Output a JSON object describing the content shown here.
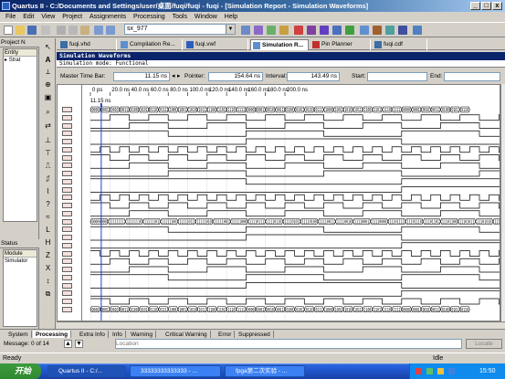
{
  "window": {
    "title": "Quartus II - C:/Documents and Settings/user/桌面/fuqi/fuqi - fuqi - [Simulation Report - Simulation Waveforms]",
    "controls": [
      "_",
      "□",
      "x"
    ]
  },
  "menu": [
    "File",
    "Edit",
    "View",
    "Project",
    "Assignments",
    "Processing",
    "Tools",
    "Window",
    "Help"
  ],
  "toolbar": {
    "entity_combo": "sx_977"
  },
  "left_panel": {
    "project_header": "Project N",
    "entity_col": "Entity",
    "entity_row": "Strat",
    "status_header": "Status",
    "status_col": "Module",
    "status_row": "Simulator"
  },
  "tabs": [
    {
      "label": "fuqi.vhd",
      "active": false,
      "icon_color": "#3a6ea5"
    },
    {
      "label": "Compilation Re...",
      "active": false,
      "icon_color": "#5b8fd0"
    },
    {
      "label": "fuqi.vwf",
      "active": false,
      "icon_color": "#2b5fbe"
    },
    {
      "label": "Simulation R...",
      "active": true,
      "icon_color": "#5b8fd0"
    },
    {
      "label": "Pin Planner",
      "active": false,
      "icon_color": "#c03030"
    },
    {
      "label": "fuqi.cdf",
      "active": false,
      "icon_color": "#3a6ea5"
    }
  ],
  "report": {
    "header": "Simulation Waveforms",
    "mode": "Simulation mode: Functional"
  },
  "timebar": {
    "master_label": "Master Time Bar:",
    "master_value": "11.15 ns",
    "pointer_label": "Pointer:",
    "pointer_value": "154.64 ns",
    "interval_label": "Interval:",
    "interval_value": "143.49 ns",
    "start_label": "Start:",
    "end_label": "End:"
  },
  "waveform": {
    "ruler": [
      "0 ps",
      "20.0 ns",
      "40.0 ns",
      "60.0 ns",
      "80.0 ns",
      "100.0 ns",
      "120.0 ns",
      "140.0 ns",
      "160.0 ns",
      "180.0 ns",
      "200.0 ns"
    ],
    "cursor_label": "11.15 ns",
    "bus_top_values": [
      "0000",
      "0001",
      "0010",
      "0011",
      "0100",
      "0101",
      "0110",
      "0111",
      "1000",
      "1001",
      "1010",
      "1011",
      "1100",
      "1101",
      "1110",
      "1111",
      "0000",
      "0001",
      "0010",
      "0011",
      "0100",
      "0101",
      "0110",
      "0111",
      "1000",
      "1001",
      "1010",
      "1011",
      "1100",
      "1101",
      "1110",
      "1111",
      "0000",
      "0001",
      "0010",
      "0011",
      "0100",
      "0101",
      "0110"
    ],
    "bus_mid_values": [
      "00000000",
      "11111111",
      "11111110",
      "11111101",
      "11111100",
      "11111011",
      "11111010",
      "11111001",
      "11111000",
      "11110111",
      "11110110",
      "11110101",
      "11110100",
      "11110011",
      "11110010",
      "11110001",
      "11110000",
      "11101111",
      "11101110",
      "11101101",
      "11101100",
      "11101011",
      "11101010",
      "11101001"
    ],
    "bus_bottom_values": [
      "0000",
      "0001",
      "0010",
      "0011",
      "0100",
      "0101",
      "0110",
      "0111",
      "1000",
      "1001",
      "1010",
      "1011",
      "1100",
      "1101",
      "1110",
      "1111",
      "0000",
      "0001",
      "0010",
      "0011",
      "0100",
      "0101",
      "0110",
      "0111",
      "1000",
      "1001",
      "1010",
      "1011",
      "1100",
      "1101",
      "1110",
      "1111",
      "0000",
      "0001",
      "0010",
      "0011",
      "0100",
      "0101",
      "0110"
    ]
  },
  "messages": {
    "tabs": [
      "System",
      "Processing",
      "Extra Info",
      "Info",
      "Warning",
      "Critical Warning",
      "Error",
      "Suppressed"
    ],
    "active_tab": "Processing",
    "count": "Message: 0 of 14",
    "location_placeholder": "Location",
    "locate_button": "Locate"
  },
  "status": {
    "left": "Ready",
    "right": "Idle"
  },
  "taskbar": {
    "start": "开始",
    "tasks": [
      "Quartus II - C:/...",
      "33333333333333 - ...",
      "fpga第二次实验 - ..."
    ],
    "clock": "15:50"
  }
}
